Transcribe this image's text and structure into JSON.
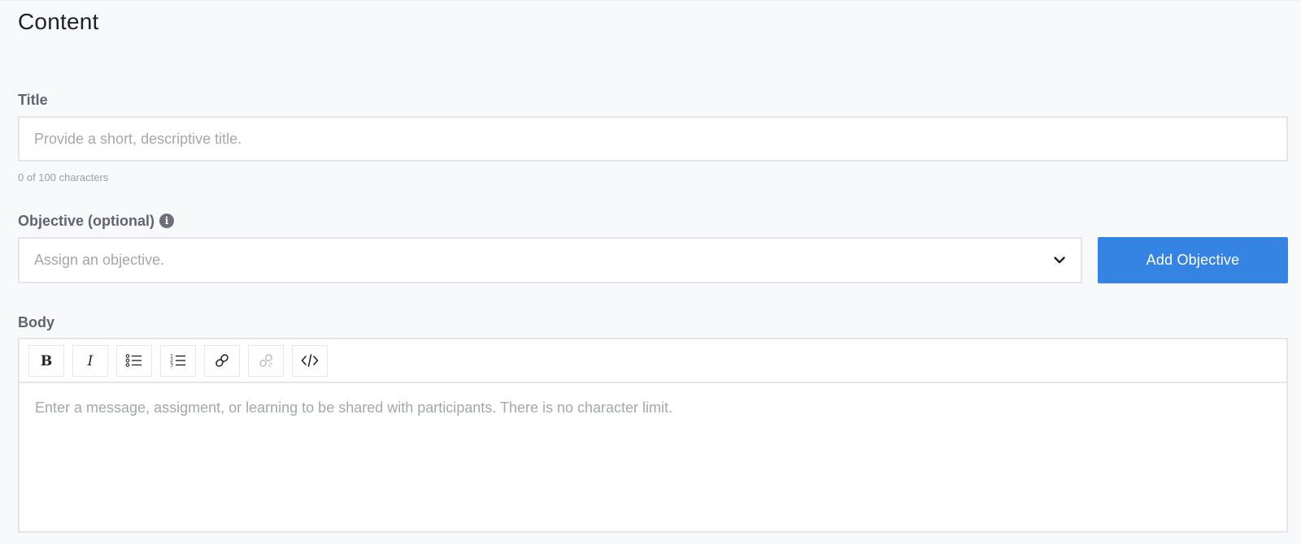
{
  "section": {
    "title": "Content"
  },
  "title_field": {
    "label": "Title",
    "value": "",
    "placeholder": "Provide a short, descriptive title.",
    "counter": "0 of 100 characters"
  },
  "objective_field": {
    "label": "Objective (optional)",
    "info_icon": "info-icon",
    "placeholder": "Assign an objective.",
    "dropdown_icon": "chevron-down-icon",
    "add_button_label": "Add Objective",
    "add_button_color": "#3584e4"
  },
  "body_field": {
    "label": "Body",
    "placeholder": "Enter a message, assigment, or learning to be shared with participants. There is no character limit.",
    "toolbar": [
      {
        "name": "bold",
        "icon": "bold-icon",
        "enabled": true
      },
      {
        "name": "italic",
        "icon": "italic-icon",
        "enabled": true
      },
      {
        "name": "bulleted-list",
        "icon": "bulleted-list-icon",
        "enabled": true
      },
      {
        "name": "numbered-list",
        "icon": "numbered-list-icon",
        "enabled": true
      },
      {
        "name": "link",
        "icon": "link-icon",
        "enabled": true
      },
      {
        "name": "unlink",
        "icon": "unlink-icon",
        "enabled": false
      },
      {
        "name": "code",
        "icon": "code-icon",
        "enabled": true
      }
    ]
  }
}
